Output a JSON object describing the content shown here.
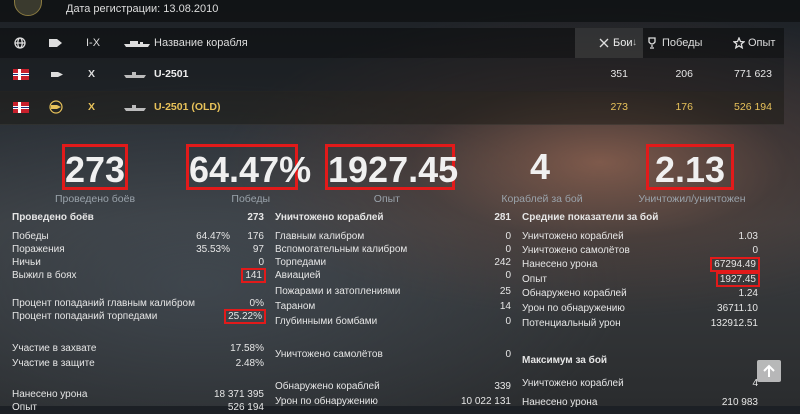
{
  "top": {
    "reg_date": "Дата регистрации: 13.08.2010"
  },
  "header": {
    "tier": "I-X",
    "ship_name": "Название корабля",
    "battles": "Бои",
    "battles_sort_arrow": "↓",
    "wins": "Победы",
    "exp": "Опыт"
  },
  "ships": [
    {
      "tier": "X",
      "name": "U-2501",
      "battles": "351",
      "wins": "206",
      "exp": "771 623"
    },
    {
      "tier": "X",
      "name": "U-2501 (OLD)",
      "battles": "273",
      "wins": "176",
      "exp": "526 194"
    }
  ],
  "big": [
    {
      "value": "273",
      "label": "Проведено боёв"
    },
    {
      "value": "64.47%",
      "label": "Победы"
    },
    {
      "value": "1927.45",
      "label": "Опыт"
    },
    {
      "value": "4",
      "label": "Кораблей за бой"
    },
    {
      "value": "2.13",
      "label": "Уничтожил/уничтожен"
    }
  ],
  "left_table": {
    "title": "Проведено боёв",
    "title_value": "273",
    "rows": [
      {
        "label": "Победы",
        "pct": "64.47%",
        "value": "176"
      },
      {
        "label": "Поражения",
        "pct": "35.53%",
        "value": "97"
      },
      {
        "label": "Ничьи",
        "pct": "",
        "value": "0"
      },
      {
        "label": "Выжил в боях",
        "pct": "",
        "value": "141"
      }
    ],
    "rows2": [
      {
        "label": "Процент попаданий главным калибром",
        "value": "0%"
      },
      {
        "label": "Процент попаданий торпедами",
        "value": "25.22%"
      }
    ],
    "rows3": [
      {
        "label": "Участие в захвате",
        "value": "17.58%"
      },
      {
        "label": "Участие в защите",
        "value": "2.48%"
      }
    ],
    "rows4": [
      {
        "label": "Нанесено урона",
        "value": "18 371 395"
      },
      {
        "label": "Опыт",
        "value": "526 194"
      }
    ]
  },
  "mid_table": {
    "title": "Уничтожено кораблей",
    "title_value": "281",
    "rows": [
      {
        "label": "Главным калибром",
        "value": "0"
      },
      {
        "label": "Вспомогательным калибром",
        "value": "0"
      },
      {
        "label": "Торпедами",
        "value": "242"
      },
      {
        "label": "Авиацией",
        "value": "0"
      },
      {
        "label": "Пожарами и затоплениями",
        "value": "25"
      },
      {
        "label": "Тараном",
        "value": "14"
      },
      {
        "label": "Глубинными бомбами",
        "value": "0"
      }
    ],
    "planes": {
      "label": "Уничтожено самолётов",
      "value": "0"
    },
    "rows2": [
      {
        "label": "Обнаружено кораблей",
        "value": "339"
      },
      {
        "label": "Урон по обнаружению",
        "value": "10 022 131"
      }
    ]
  },
  "right_table": {
    "title": "Средние показатели за бой",
    "rows": [
      {
        "label": "Уничтожено кораблей",
        "value": "1.03"
      },
      {
        "label": "Уничтожено самолётов",
        "value": "0"
      },
      {
        "label": "Нанесено урона",
        "value": "67294.49"
      },
      {
        "label": "Опыт",
        "value": "1927.45"
      },
      {
        "label": "Обнаружено кораблей",
        "value": "1.24"
      },
      {
        "label": "Урон по обнаружению",
        "value": "36711.10"
      },
      {
        "label": "Потенциальный урон",
        "value": "132912.51"
      }
    ],
    "max_title": "Максимум за бой",
    "max_rows": [
      {
        "label": "Уничтожено кораблей",
        "value": "4"
      },
      {
        "label": "Нанесено урона",
        "value": "210 983"
      }
    ]
  }
}
